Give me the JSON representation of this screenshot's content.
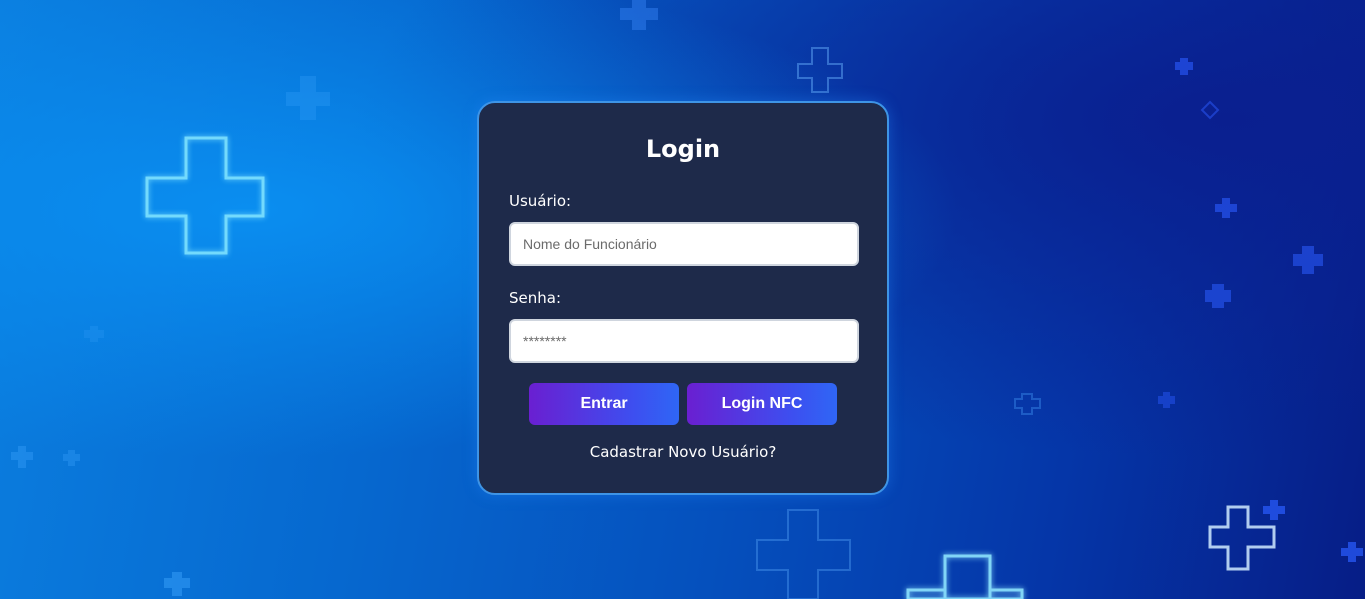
{
  "login": {
    "title": "Login",
    "username_label": "Usuário:",
    "username_placeholder": "Nome do Funcionário",
    "password_label": "Senha:",
    "password_placeholder": "********",
    "enter_button": "Entrar",
    "nfc_button": "Login NFC",
    "register_link": "Cadastrar Novo Usuário?"
  },
  "colors": {
    "card_background": "#1e2a4a",
    "card_border": "#3e94e6",
    "button_gradient_start": "#6a1fd1",
    "button_gradient_end": "#2f66f5",
    "background_light": "#0b7fe0",
    "background_dark": "#061d86"
  },
  "background": {
    "icon": "medical-cross-icon"
  }
}
